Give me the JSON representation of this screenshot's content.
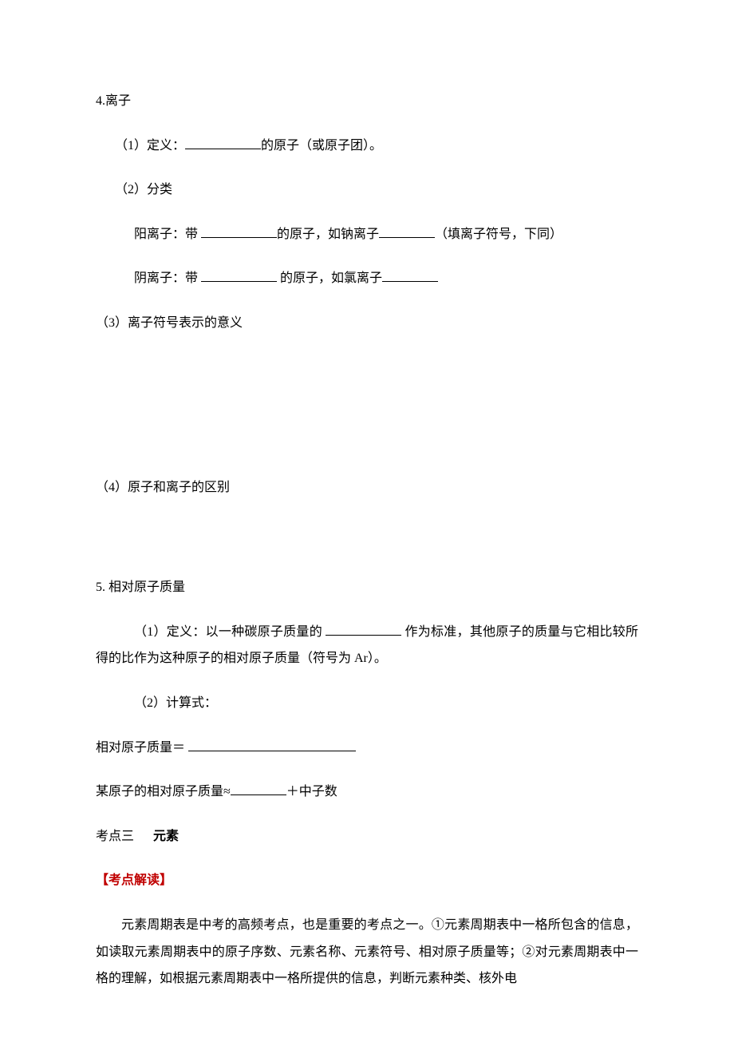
{
  "s4": {
    "title": "4.离子",
    "p1_a": "（1）定义：",
    "p1_b": "的原子（或原子团）。",
    "p2": "（2）分类",
    "p2a_a": "阳离子：带 ",
    "p2a_b": "的原子，如钠离子",
    "p2a_c": "（填离子符号，下同）",
    "p2b_a": "阴离子：带 ",
    "p2b_b": " 的原子，如氯离子",
    "p3": "（3）离子符号表示的意义",
    "p4": "（4）原子和离子的区别"
  },
  "s5": {
    "title": "5.  相对原子质量",
    "p1_a": "（1）定义：以一种碳原子质量的 ",
    "p1_b": " 作为标准，其他原子的质量与它相比较所得的比作为这种原子的相对原子质量（符号为 Ar）。",
    "p2": "（2）计算式：",
    "p3": "相对原子质量＝  ",
    "p4_a": "某原子的相对原子质量≈",
    "p4_b": "＋中子数"
  },
  "topic": {
    "pre": "考点三",
    "main": "元素"
  },
  "reading": {
    "title": "【考点解读】",
    "body": "元素周期表是中考的高频考点，也是重要的考点之一。①元素周期表中一格所包含的信息，如读取元素周期表中的原子序数、元素名称、元素符号、相对原子质量等；②对元素周期表中一格的理解，如根据元素周期表中一格所提供的信息，判断元素种类、核外电"
  }
}
